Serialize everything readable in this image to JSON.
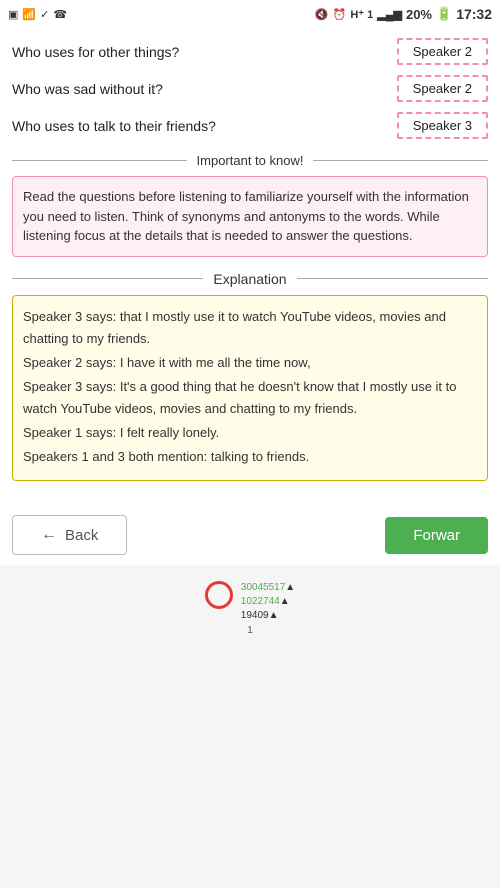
{
  "statusBar": {
    "time": "17:32",
    "battery": "20%",
    "icons": [
      "screen",
      "wifi",
      "check",
      "phone",
      "mute",
      "clock",
      "signal1",
      "signal2",
      "signal3"
    ]
  },
  "questions": [
    {
      "text": "Who uses for other things?",
      "answer": "Speaker 2"
    },
    {
      "text": "Who was sad without it?",
      "answer": "Speaker 2"
    },
    {
      "text": "Who uses to talk to their friends?",
      "answer": "Speaker 3"
    }
  ],
  "importantLabel": "Important to know!",
  "infoText": "Read the questions before listening to familiarize yourself with the information you need to listen. Think of synonyms and antonyms to the words. While listening focus at the details that is needed to answer the questions.",
  "explanationLabel": "Explanation",
  "explanationLines": [
    "Speaker 3 says: that I mostly use it to watch YouTube videos, movies and chatting to my friends.",
    "Speaker 2 says: I have it with me all the time now,",
    "Speaker 3 says: It's a good thing that he doesn't know that I mostly use it to watch YouTube videos, movies and chatting to my friends.",
    "Speaker 1 says: I felt really lonely.",
    "Speakers 1 and 3 both mention: talking to friends."
  ],
  "buttons": {
    "back": "Back",
    "forward": "Forwar"
  },
  "footer": {
    "num1": "1",
    "num2": "30045517",
    "num3": "1022744",
    "num4": "19409"
  }
}
